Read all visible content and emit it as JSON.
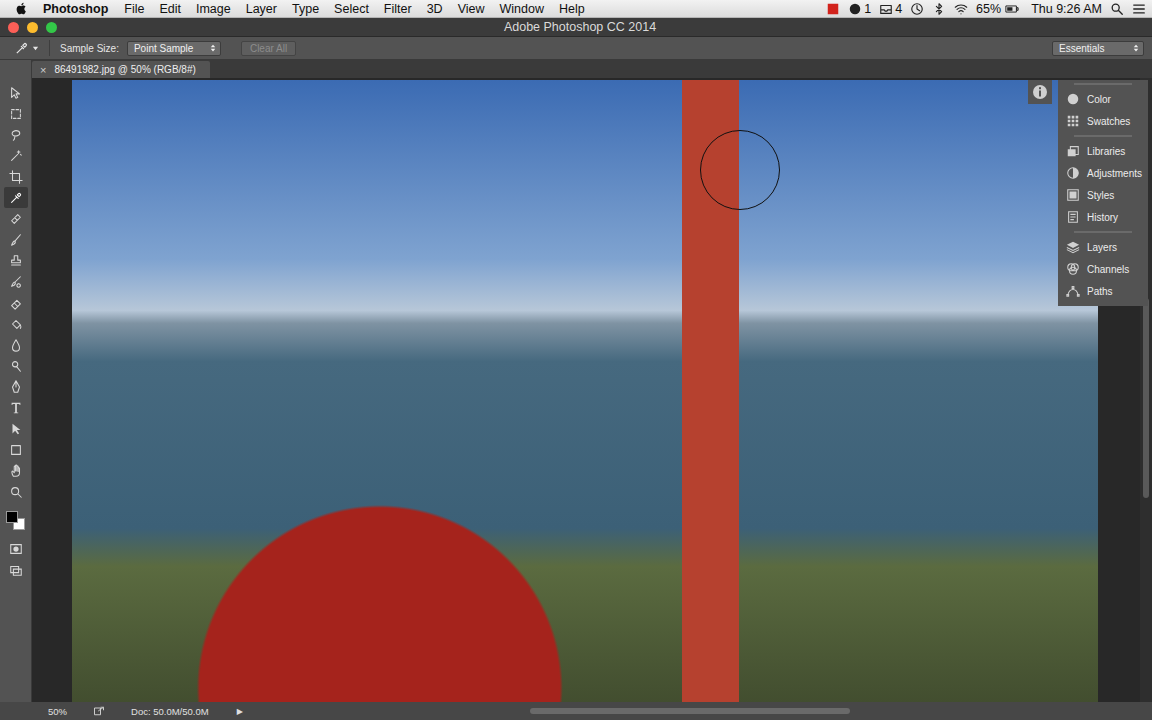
{
  "menubar": {
    "app": "Photoshop",
    "menus": [
      "File",
      "Edit",
      "Image",
      "Layer",
      "Type",
      "Select",
      "Filter",
      "3D",
      "View",
      "Window",
      "Help"
    ],
    "status_icons": [
      {
        "kind": "red-app"
      },
      {
        "kind": "cc",
        "count": "1"
      },
      {
        "kind": "tray",
        "count": "4"
      },
      {
        "kind": "time-machine"
      },
      {
        "kind": "bluetooth"
      },
      {
        "kind": "wifi"
      }
    ],
    "battery": "65%",
    "clock": "Thu 9:26 AM",
    "tail_icons": [
      {
        "kind": "search"
      },
      {
        "kind": "list"
      }
    ]
  },
  "window": {
    "title": "Adobe Photoshop CC 2014"
  },
  "options_bar": {
    "sample_size_label": "Sample Size:",
    "sample_size": "Point Sample",
    "clear_button": "Clear All",
    "clear_disabled": true,
    "workspace": "Essentials"
  },
  "document_tab": {
    "close": "×",
    "title": "86491982.jpg @ 50% (RGB/8#)"
  },
  "tools": [
    {
      "kind": "move",
      "selected": false
    },
    {
      "kind": "marquee",
      "selected": false
    },
    {
      "kind": "lasso",
      "selected": false
    },
    {
      "kind": "quick-select",
      "selected": false
    },
    {
      "kind": "crop",
      "selected": false
    },
    {
      "kind": "eyedropper",
      "selected": true
    },
    {
      "kind": "healing",
      "selected": false
    },
    {
      "kind": "brush",
      "selected": false
    },
    {
      "kind": "stamp",
      "selected": false
    },
    {
      "kind": "history-brush",
      "selected": false
    },
    {
      "kind": "eraser",
      "selected": false
    },
    {
      "kind": "bucket",
      "selected": false
    },
    {
      "kind": "blur",
      "selected": false
    },
    {
      "kind": "dodge",
      "selected": false
    },
    {
      "kind": "pen",
      "selected": false
    },
    {
      "kind": "type",
      "selected": false
    },
    {
      "kind": "path-select",
      "selected": false
    },
    {
      "kind": "shape",
      "selected": false
    },
    {
      "kind": "hand",
      "selected": false
    },
    {
      "kind": "zoom",
      "selected": false
    }
  ],
  "swatches": {
    "foreground": "#000000",
    "background": "#ffffff"
  },
  "panel_groups": [
    [
      {
        "label": "Color",
        "kind": "color"
      },
      {
        "label": "Swatches",
        "kind": "swatches"
      }
    ],
    [
      {
        "label": "Libraries",
        "kind": "libraries"
      },
      {
        "label": "Adjustments",
        "kind": "adjustments"
      },
      {
        "label": "Styles",
        "kind": "styles"
      },
      {
        "label": "History",
        "kind": "history"
      }
    ],
    [
      {
        "label": "Layers",
        "kind": "layers"
      },
      {
        "label": "Channels",
        "kind": "channels"
      },
      {
        "label": "Paths",
        "kind": "paths"
      }
    ]
  ],
  "status_bar": {
    "zoom": "50%",
    "doc": "Doc: 50.0M/50.0M",
    "arrow": "▶"
  }
}
